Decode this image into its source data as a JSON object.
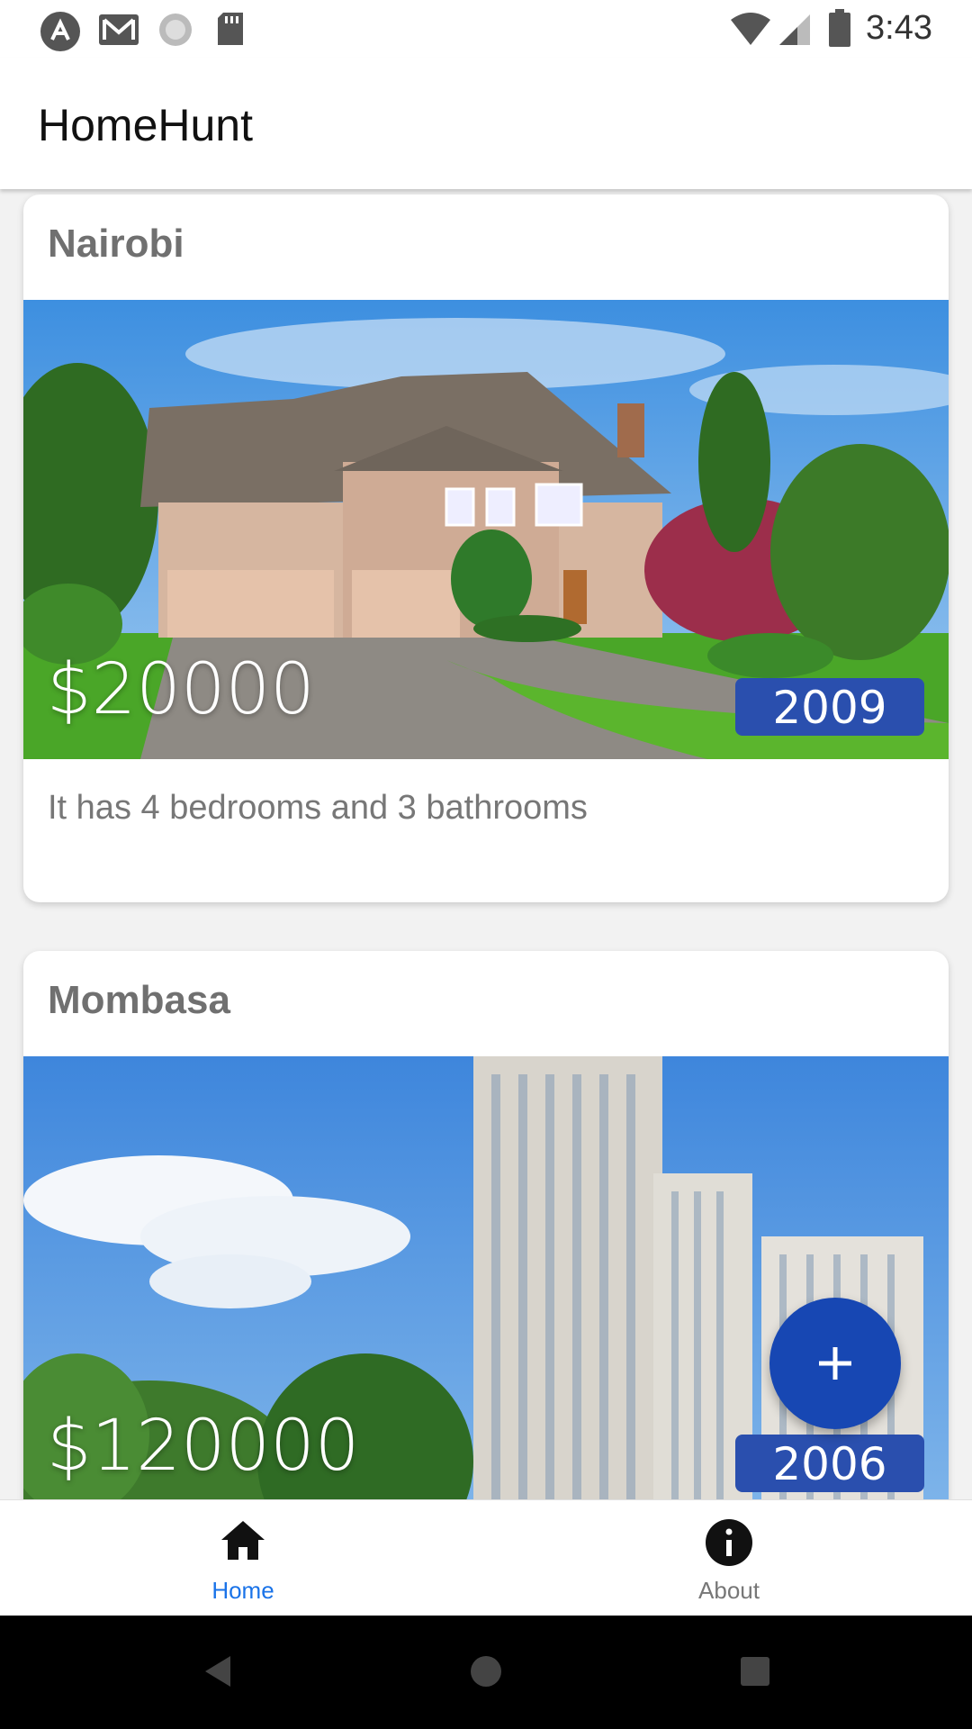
{
  "status_bar": {
    "time": "3:43",
    "icons": [
      "app-icon",
      "gmail-icon",
      "sync-icon",
      "sd-card-icon",
      "wifi-icon",
      "signal-icon",
      "battery-icon"
    ]
  },
  "app": {
    "title": "HomeHunt"
  },
  "listings": [
    {
      "city": "Nairobi",
      "price": "$20000",
      "year": "2009",
      "description": "It has 4 bedrooms and 3 bathrooms"
    },
    {
      "city": "Mombasa",
      "price": "$120000",
      "year": "2006"
    }
  ],
  "fab": {
    "icon": "plus-icon"
  },
  "bottom_nav": {
    "items": [
      {
        "label": "Home",
        "icon": "home-icon",
        "active": true
      },
      {
        "label": "About",
        "icon": "info-icon",
        "active": false
      }
    ],
    "active_color": "#1a73e8",
    "inactive_color": "#777777"
  },
  "colors": {
    "accent": "#1747b3",
    "badge": "#2a4fae"
  }
}
